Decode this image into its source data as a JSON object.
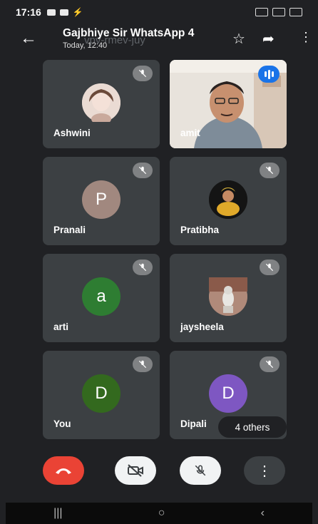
{
  "status_bar": {
    "time": "17:16"
  },
  "header": {
    "title": "Gajbhiye Sir WhatsApp 4",
    "subtitle": "Today, 12:40",
    "ghost_code": "vpv-rmev-juy"
  },
  "participants": [
    {
      "name": "Ashwini",
      "avatar_type": "photo",
      "muted": true
    },
    {
      "name": "amit",
      "avatar_type": "video",
      "speaking": true
    },
    {
      "name": "Pranali",
      "initial": "P",
      "color": "#a1887f",
      "muted": true
    },
    {
      "name": "Pratibha",
      "avatar_type": "photo",
      "muted": true
    },
    {
      "name": "arti",
      "initial": "a",
      "color": "#2e7d32",
      "muted": true
    },
    {
      "name": "jaysheela",
      "avatar_type": "photo",
      "muted": true
    },
    {
      "name": "You",
      "initial": "D",
      "color": "#33691e",
      "muted": true
    },
    {
      "name": "Dipali",
      "initial": "D",
      "color": "#7e57c2",
      "muted": true
    }
  ],
  "others_chip": "4 others",
  "controls": {
    "end_call_color": "#ea4335",
    "camera_state": "off",
    "mic_state": "off"
  },
  "colors": {
    "tile_bg": "#3c4043",
    "page_bg": "#202124",
    "speaking_accent": "#1a73e8"
  }
}
